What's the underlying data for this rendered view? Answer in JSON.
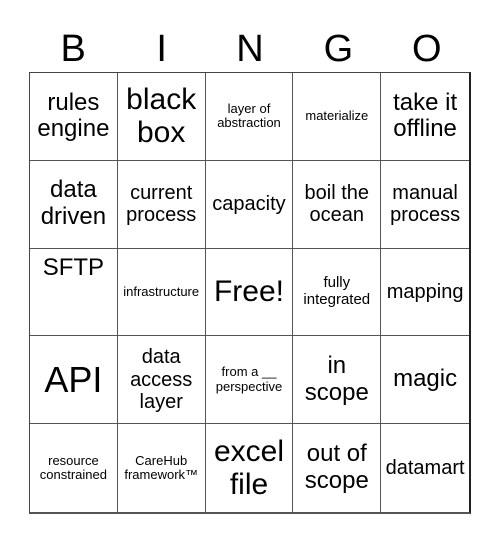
{
  "header": {
    "letters": [
      "B",
      "I",
      "N",
      "G",
      "O"
    ]
  },
  "cells": [
    "rules engine",
    "black box",
    "layer of abstraction",
    "materialize",
    "take it offline",
    "data driven",
    "current process",
    "capacity",
    "boil the ocean",
    "manual process",
    "SFTP",
    "infrastructure",
    "Free!",
    "fully integrated",
    "mapping",
    "API",
    "data access layer",
    "from a __ perspective",
    "in scope",
    "magic",
    "resource constrained",
    "CareHub framework™",
    "excel file",
    "out of scope",
    "datamart"
  ]
}
